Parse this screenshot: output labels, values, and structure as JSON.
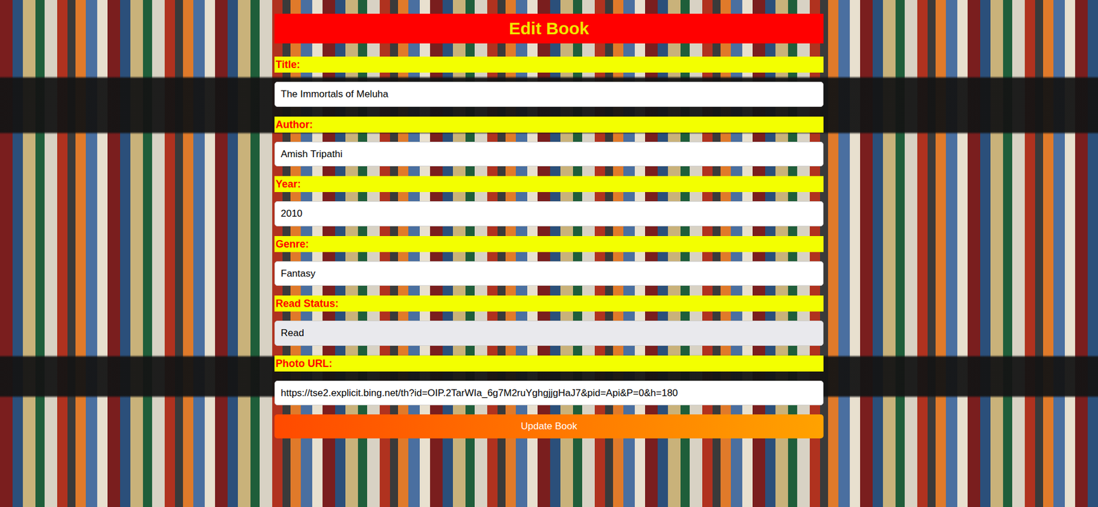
{
  "heading": "Edit Book",
  "fields": [
    {
      "label": "Title:",
      "value": "The Immortals of Meluha",
      "kind": "text"
    },
    {
      "label": "Author:",
      "value": "Amish Tripathi",
      "kind": "text"
    },
    {
      "label": "Year:",
      "value": "2010",
      "kind": "text"
    },
    {
      "label": "Genre:",
      "value": "Fantasy",
      "kind": "text"
    },
    {
      "label": "Read Status:",
      "value": "Read",
      "kind": "select"
    },
    {
      "label": "Photo URL:",
      "value": "https://tse2.explicit.bing.net/th?id=OIP.2TarWIa_6g7M2ruYghgjjgHaJ7&pid=Api&P=0&h=180",
      "kind": "text"
    }
  ],
  "button": "Update Book"
}
